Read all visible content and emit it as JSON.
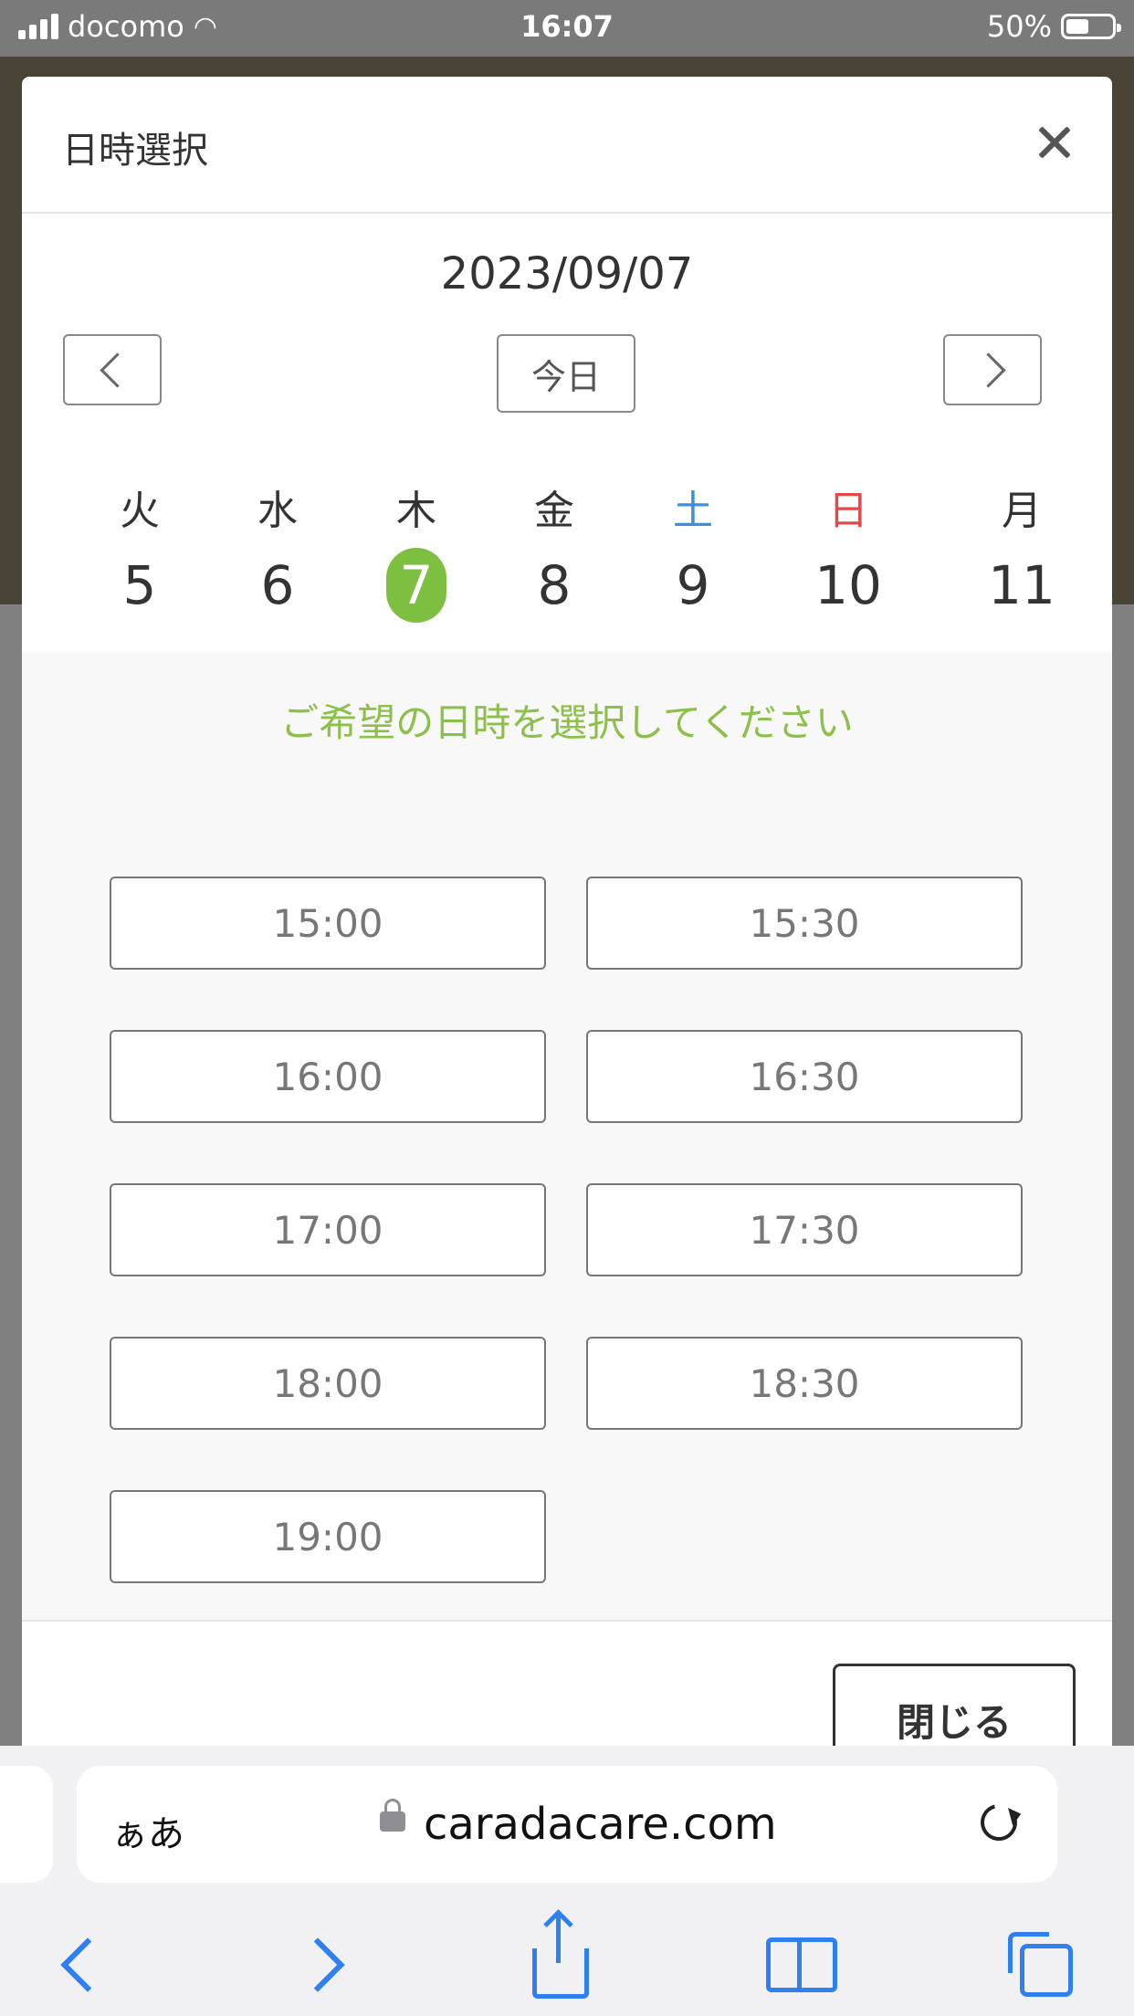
{
  "status_bar": {
    "carrier": "docomo",
    "time": "16:07",
    "battery_percent": "50%",
    "battery_level": 0.5
  },
  "modal": {
    "title": "日時選択",
    "date": "2023/09/07",
    "today_label": "今日",
    "days": [
      {
        "weekday": "火",
        "day": "5",
        "type": "weekday"
      },
      {
        "weekday": "水",
        "day": "6",
        "type": "weekday"
      },
      {
        "weekday": "木",
        "day": "7",
        "type": "weekday",
        "selected": true
      },
      {
        "weekday": "金",
        "day": "8",
        "type": "weekday"
      },
      {
        "weekday": "土",
        "day": "9",
        "type": "saturday"
      },
      {
        "weekday": "日",
        "day": "10",
        "type": "sunday"
      },
      {
        "weekday": "月",
        "day": "11",
        "type": "weekday"
      }
    ],
    "prompt": "ご希望の日時を選択してください",
    "time_slots": [
      "15:00",
      "15:30",
      "16:00",
      "16:30",
      "17:00",
      "17:30",
      "18:00",
      "18:30",
      "19:00"
    ],
    "close_label": "閉じる"
  },
  "safari": {
    "text_size_label": "ぁあ",
    "url": "caradacare.com"
  },
  "colors": {
    "accent_green": "#7dbf40",
    "saturday_blue": "#3a8fde",
    "sunday_red": "#e04a4a",
    "ios_blue": "#2f7ff0"
  },
  "icons": [
    "close-icon",
    "chevron-left-icon",
    "chevron-right-icon",
    "lock-icon",
    "reload-icon",
    "share-icon",
    "bookmarks-icon",
    "tabs-icon",
    "wifi-icon",
    "signal-icon",
    "battery-icon"
  ]
}
